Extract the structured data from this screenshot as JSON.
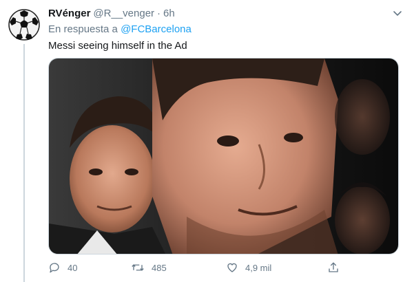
{
  "author": {
    "display_name": "RVénger",
    "handle": "@R__venger",
    "separator": "·",
    "time": "6h"
  },
  "reply_context": {
    "prefix": "En respuesta a",
    "mention": "@FCBarcelona"
  },
  "tweet": {
    "text": "Messi seeing himself in the Ad"
  },
  "actions": {
    "reply_count": "40",
    "retweet_count": "485",
    "like_count": "4,9 mil"
  },
  "icons": {
    "avatar": "soccer-ball-avatar",
    "caret": "chevron-down-icon",
    "reply": "reply-icon",
    "retweet": "retweet-icon",
    "like": "heart-icon",
    "share": "share-icon"
  },
  "colors": {
    "link": "#1da1f2",
    "secondary_text": "#657786",
    "primary_text": "#14171a",
    "thread_line": "#ccd6dd"
  }
}
